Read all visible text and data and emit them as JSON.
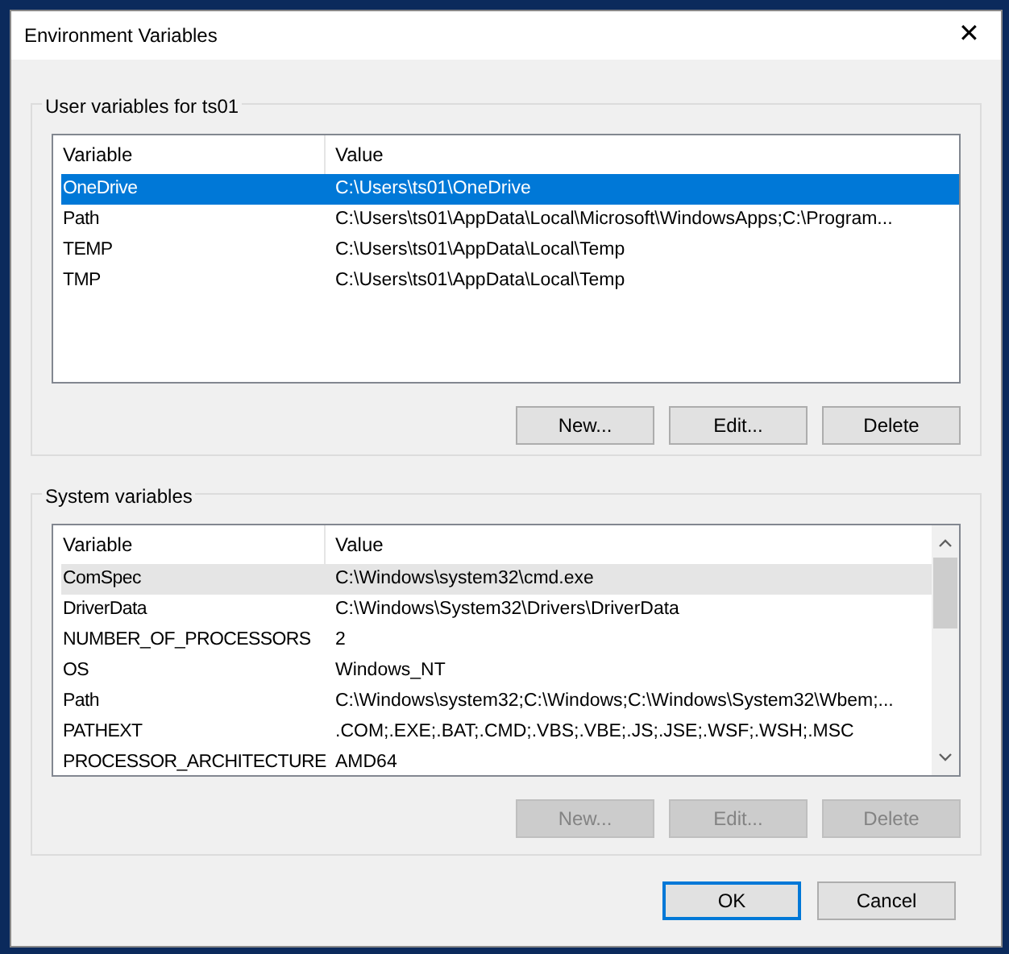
{
  "window": {
    "title": "Environment Variables",
    "close": "✕"
  },
  "user_variables": {
    "title": "User variables for ts01",
    "columns": [
      "Variable",
      "Value"
    ],
    "rows": [
      {
        "variable": "OneDrive",
        "value": "C:\\Users\\ts01\\OneDrive",
        "selected": true,
        "highlighted": false
      },
      {
        "variable": "Path",
        "value": "C:\\Users\\ts01\\AppData\\Local\\Microsoft\\WindowsApps;C:\\Program...",
        "selected": false,
        "highlighted": false
      },
      {
        "variable": "TEMP",
        "value": "C:\\Users\\ts01\\AppData\\Local\\Temp",
        "selected": false,
        "highlighted": false
      },
      {
        "variable": "TMP",
        "value": "C:\\Users\\ts01\\AppData\\Local\\Temp",
        "selected": false,
        "highlighted": false
      }
    ],
    "buttons": [
      {
        "label": "New...",
        "disabled": false
      },
      {
        "label": "Edit...",
        "disabled": false
      },
      {
        "label": "Delete",
        "disabled": false
      }
    ]
  },
  "system_variables": {
    "title": "System variables",
    "columns": [
      "Variable",
      "Value"
    ],
    "scrollbar": true,
    "rows": [
      {
        "variable": "ComSpec",
        "value": "C:\\Windows\\system32\\cmd.exe",
        "selected": false,
        "highlighted": true
      },
      {
        "variable": "DriverData",
        "value": "C:\\Windows\\System32\\Drivers\\DriverData",
        "selected": false,
        "highlighted": false
      },
      {
        "variable": "NUMBER_OF_PROCESSORS",
        "value": "2",
        "selected": false,
        "highlighted": false
      },
      {
        "variable": "OS",
        "value": "Windows_NT",
        "selected": false,
        "highlighted": false
      },
      {
        "variable": "Path",
        "value": "C:\\Windows\\system32;C:\\Windows;C:\\Windows\\System32\\Wbem;...",
        "selected": false,
        "highlighted": false
      },
      {
        "variable": "PATHEXT",
        "value": ".COM;.EXE;.BAT;.CMD;.VBS;.VBE;.JS;.JSE;.WSF;.WSH;.MSC",
        "selected": false,
        "highlighted": false
      },
      {
        "variable": "PROCESSOR_ARCHITECTURE",
        "value": "AMD64",
        "selected": false,
        "highlighted": false
      }
    ],
    "buttons": [
      {
        "label": "New...",
        "disabled": true
      },
      {
        "label": "Edit...",
        "disabled": true
      },
      {
        "label": "Delete",
        "disabled": true
      }
    ]
  },
  "dialog_buttons": [
    {
      "label": "OK",
      "default": true
    },
    {
      "label": "Cancel",
      "default": false
    }
  ]
}
